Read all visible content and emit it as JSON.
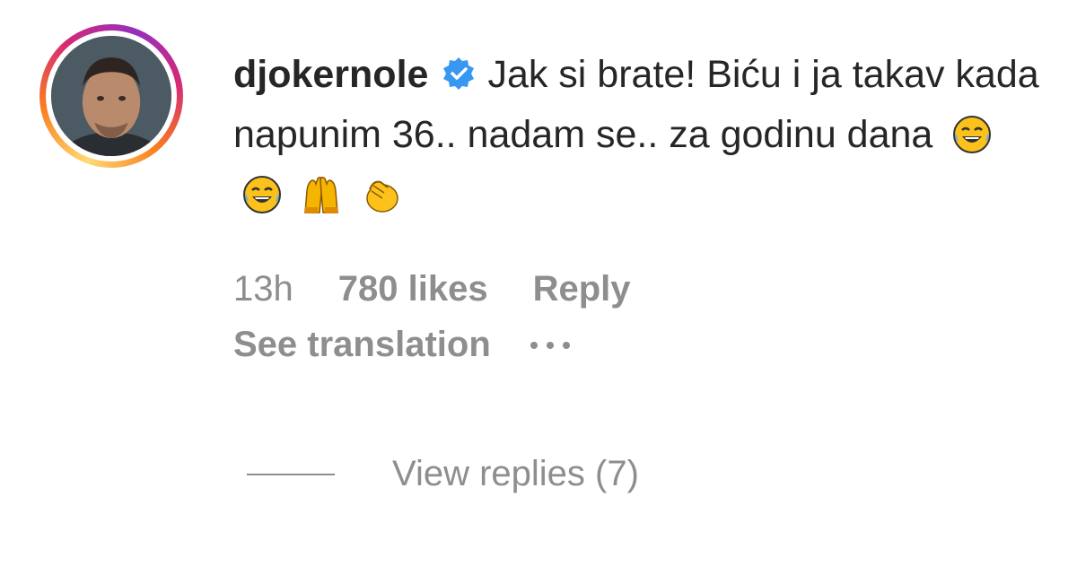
{
  "comment": {
    "username": "djokernole",
    "verified": true,
    "text": "Jak si brate! Biću i ja takav kada napunim 36.. nadam se.. za godinu dana",
    "emojis": [
      "joy-emoji",
      "joy-emoji",
      "raising-hands-emoji",
      "clapping-hands-emoji"
    ]
  },
  "meta": {
    "time": "13h",
    "likes": "780 likes",
    "reply": "Reply",
    "see_translation": "See translation"
  },
  "replies": {
    "label": "View replies (7)"
  },
  "colors": {
    "verified_blue": "#3897f0",
    "muted_text": "#8e8e8e",
    "primary_text": "#262626"
  }
}
